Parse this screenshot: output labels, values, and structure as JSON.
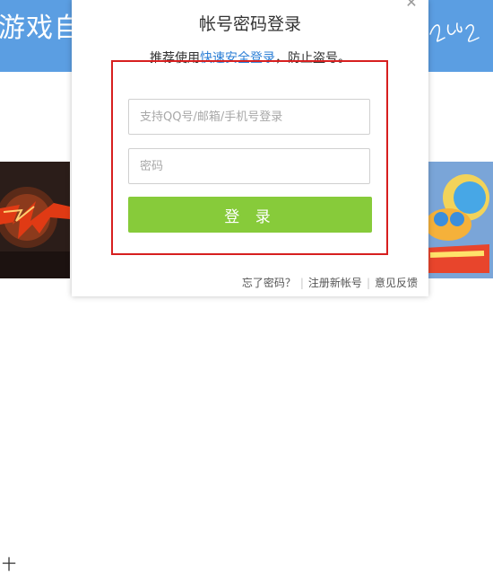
{
  "background": {
    "header_title": "游戏自由",
    "footer_glyph": "十"
  },
  "login": {
    "title": "帐号密码登录",
    "subtitle_prefix": "推荐使用",
    "subtitle_link": "快速安全登录",
    "subtitle_suffix": "，防止盗号。",
    "account_placeholder": "支持QQ号/邮箱/手机号登录",
    "password_placeholder": "密码",
    "login_button": "登 录",
    "close_glyph": "✕",
    "links": {
      "forgot_password": "忘了密码？",
      "register": "注册新帐号",
      "feedback": "意见反馈"
    }
  },
  "colors": {
    "header_blue": "#5b9ee2",
    "login_green": "#87cb3a",
    "link_blue": "#2d7fd6",
    "highlight_red": "#d71f1f"
  }
}
